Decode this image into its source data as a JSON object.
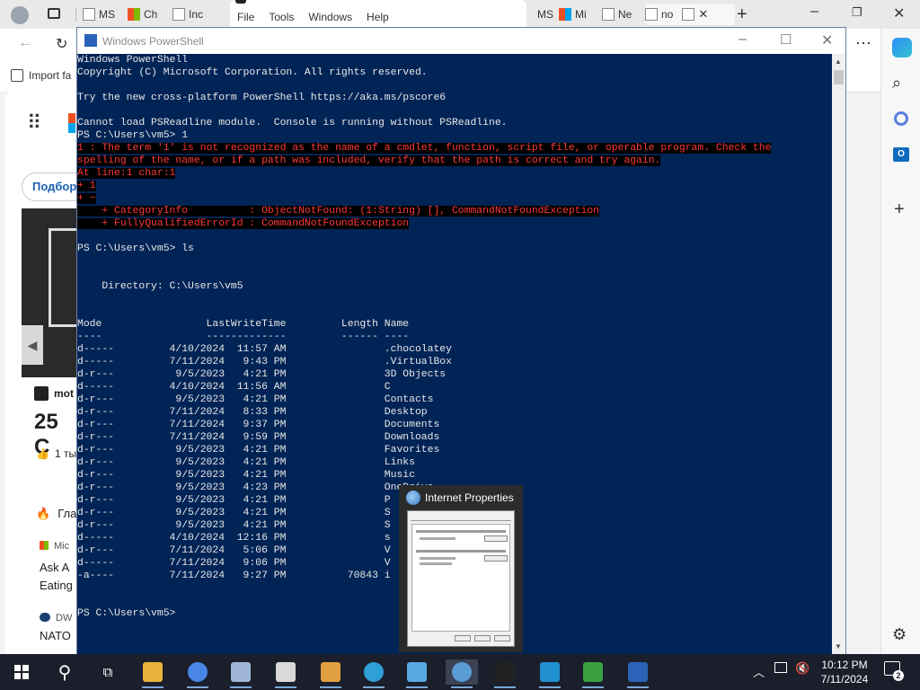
{
  "browser": {
    "tabs": [
      {
        "label": "MS"
      },
      {
        "label": "Ch"
      },
      {
        "label": "Inc"
      },
      {
        "label": "MS"
      },
      {
        "label": "Mi"
      },
      {
        "label": "Ne"
      },
      {
        "label": "no"
      }
    ],
    "active_tab_menu": [
      "File",
      "Tools",
      "Windows",
      "Help"
    ],
    "favorites_bar": {
      "import_label": "Import fa"
    },
    "page_snippets": {
      "search_btn": "Подбор",
      "news_source": "mot",
      "temp": "25 C",
      "likes": "1 ты",
      "item_glavnoe": "Гла",
      "ms_source": "Mic",
      "headline_1": "Ask A",
      "headline_2": "Eating",
      "dw_source": "DW",
      "nato": "NATO"
    }
  },
  "powershell": {
    "title": "Windows PowerShell",
    "lines": [
      {
        "t": "Windows PowerShell"
      },
      {
        "t": "Copyright (C) Microsoft Corporation. All rights reserved."
      },
      {
        "t": ""
      },
      {
        "t": "Try the new cross-platform PowerShell https://aka.ms/pscore6"
      },
      {
        "t": ""
      },
      {
        "t": "Cannot load PSReadline module.  Console is running without PSReadline."
      },
      {
        "t": "PS C:\\Users\\vm5> 1"
      },
      {
        "t": "1 : The term '1' is not recognized as the name of a cmdlet, function, script file, or operable program. Check the",
        "err": true
      },
      {
        "t": "spelling of the name, or if a path was included, verify that the path is correct and try again.",
        "err": true
      },
      {
        "t": "At line:1 char:1",
        "err": true
      },
      {
        "t": "+ 1",
        "err": true
      },
      {
        "t": "+ ~",
        "err": true
      },
      {
        "t": "    + CategoryInfo          : ObjectNotFound: (1:String) [], CommandNotFoundException",
        "err": true
      },
      {
        "t": "    + FullyQualifiedErrorId : CommandNotFoundException",
        "err": true
      },
      {
        "t": ""
      },
      {
        "t": "PS C:\\Users\\vm5> ls"
      },
      {
        "t": ""
      },
      {
        "t": ""
      },
      {
        "t": "    Directory: C:\\Users\\vm5"
      },
      {
        "t": ""
      },
      {
        "t": ""
      },
      {
        "t": "Mode                 LastWriteTime         Length Name"
      },
      {
        "t": "----                 -------------         ------ ----"
      },
      {
        "t": "d-----         4/10/2024  11:57 AM                .chocolatey"
      },
      {
        "t": "d-----         7/11/2024   9:43 PM                .VirtualBox"
      },
      {
        "t": "d-r---          9/5/2023   4:21 PM                3D Objects"
      },
      {
        "t": "d-----         4/10/2024  11:56 AM                C"
      },
      {
        "t": "d-r---          9/5/2023   4:21 PM                Contacts"
      },
      {
        "t": "d-r---         7/11/2024   8:33 PM                Desktop"
      },
      {
        "t": "d-r---         7/11/2024   9:37 PM                Documents"
      },
      {
        "t": "d-r---         7/11/2024   9:59 PM                Downloads"
      },
      {
        "t": "d-r---          9/5/2023   4:21 PM                Favorites"
      },
      {
        "t": "d-r---          9/5/2023   4:21 PM                Links"
      },
      {
        "t": "d-r---          9/5/2023   4:21 PM                Music"
      },
      {
        "t": "d-r---          9/5/2023   4:23 PM                OneDrive"
      },
      {
        "t": "d-r---          9/5/2023   4:21 PM                P"
      },
      {
        "t": "d-r---          9/5/2023   4:21 PM                S"
      },
      {
        "t": "d-r---          9/5/2023   4:21 PM                S"
      },
      {
        "t": "d-----         4/10/2024  12:16 PM                s"
      },
      {
        "t": "d-r---         7/11/2024   5:06 PM                V"
      },
      {
        "t": "d-----         7/11/2024   9:06 PM                V"
      },
      {
        "t": "-a----         7/11/2024   9:27 PM          70843 i"
      },
      {
        "t": ""
      },
      {
        "t": ""
      },
      {
        "t": "PS C:\\Users\\vm5>"
      }
    ]
  },
  "thumbnail": {
    "title": "Internet Properties"
  },
  "taskbar": {
    "apps": [
      {
        "icon": "file-explorer-icon",
        "color": "#e8b33a"
      },
      {
        "icon": "chrome-icon",
        "color": "#4a86e8"
      },
      {
        "icon": "virtualbox-icon",
        "color": "#9fb6d8"
      },
      {
        "icon": "seven-zip-icon",
        "color": "#d9d9d9"
      },
      {
        "icon": "paint-icon",
        "color": "#e0a040"
      },
      {
        "icon": "edge-icon",
        "color": "#2e9fd8"
      },
      {
        "icon": "control-panel-icon",
        "color": "#5aa8e0"
      },
      {
        "icon": "internet-properties-icon",
        "color": "#5b9bd5"
      },
      {
        "icon": "command-prompt-icon",
        "color": "#222"
      },
      {
        "icon": "rdp-icon",
        "color": "#1f8fd0"
      },
      {
        "icon": "phone-icon",
        "color": "#3aa040"
      },
      {
        "icon": "powershell-icon",
        "color": "#2a63b7"
      }
    ],
    "time": "10:12 PM",
    "date": "7/11/2024",
    "notifications": "2"
  },
  "colors": {
    "console_bg": "#012456",
    "error_fg": "#ff3838",
    "taskbar_bg": "#1a1f2b"
  }
}
